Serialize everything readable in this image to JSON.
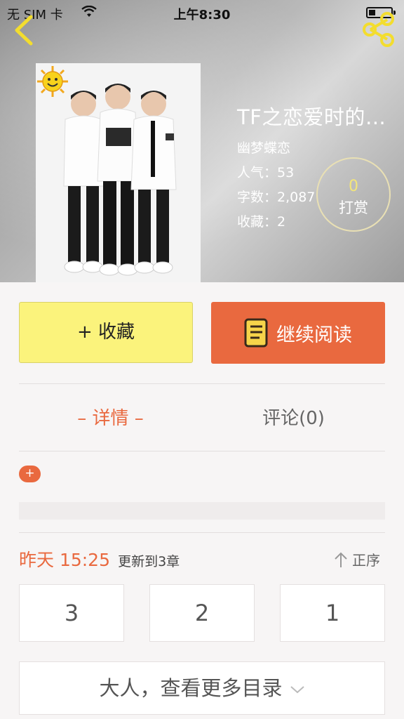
{
  "status_bar": {
    "carrier": "无 SIM 卡",
    "time": "上午8:30"
  },
  "header": {
    "back_icon": "chevron-left-icon",
    "share_icon": "share-icon"
  },
  "book": {
    "title": "TF之恋爱时的…",
    "author": "幽梦蝶恋",
    "popularity_label": "人气：53",
    "word_count_label": "字数：2,087",
    "favorites_label": "收藏：2",
    "tip_count": "0",
    "tip_label": "打赏"
  },
  "actions": {
    "collect_label": "+ 收藏",
    "continue_label": "继续阅读"
  },
  "tabs": {
    "detail": "– 详情 –",
    "comments": "评论(0)"
  },
  "tags": {
    "add_label": "+"
  },
  "catalog": {
    "update_time": "昨天 15:25",
    "update_text": "更新到3章",
    "sort_label": "正序",
    "chapters": [
      "3",
      "2",
      "1"
    ],
    "more_label": "大人，查看更多目录"
  },
  "colors": {
    "accent": "#e9693f",
    "collect_bg": "#fbf37c",
    "tip_count": "#f3e67a"
  }
}
